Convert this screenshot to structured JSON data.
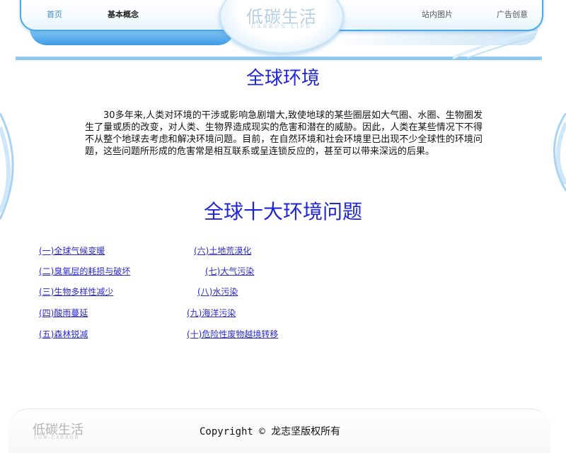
{
  "nav": {
    "home": "首页",
    "concept": "基本概念",
    "images": "站内图片",
    "ads": "广告创意"
  },
  "logo": {
    "title": "低碳生活",
    "subtitle": "CARBON LIFE"
  },
  "main": {
    "title": "全球环境",
    "intro": "30多年来,人类对环境的干涉或影响急剧增大,致使地球的某些圈层如大气圈、水圈、生物圈发生了量或质的改变，对人类、生物界造成现实的危害和潜在的威胁。因此，人类在某些情况下不得不从整个地球去考虑和解决环境问题。目前，在自然环境和社会环境里已出现不少全球性的环境问题，这些问题所形成的危害常是相互联系或呈连锁反应的，甚至可以带来深远的后果。",
    "subtitle": "全球十大环境问题",
    "links": [
      "(一)全球气候变暖",
      "(二)臭氧层的耗损与破坏",
      "(三)生物多样性减少",
      "(四)酸雨蔓延",
      "(五)森林锐减",
      "(六)土地荒漠化",
      "(七)大气污染",
      "(八)水污染",
      "(九)海洋污染",
      "(十)危险性废物越境转移"
    ]
  },
  "footer": {
    "logo": "低碳生活",
    "logo_sub": "LOW-CARBON",
    "copyright": "Copyright © 龙志坚版权所有"
  },
  "colors": {
    "accent": "#4aa8e4",
    "heading": "#1f25d8",
    "link": "#2a2ad0"
  }
}
